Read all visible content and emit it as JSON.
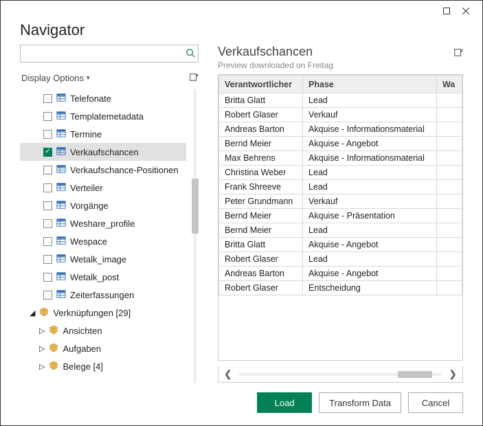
{
  "title": "Navigator",
  "search": {
    "value": ""
  },
  "display_options_label": "Display Options",
  "tree": {
    "tables": [
      {
        "label": "Telefonate",
        "checked": false,
        "selected": false
      },
      {
        "label": "Templatemetadata",
        "checked": false,
        "selected": false
      },
      {
        "label": "Termine",
        "checked": false,
        "selected": false
      },
      {
        "label": "Verkaufschancen",
        "checked": true,
        "selected": true
      },
      {
        "label": "Verkaufschance-Positionen",
        "checked": false,
        "selected": false
      },
      {
        "label": "Verteiler",
        "checked": false,
        "selected": false
      },
      {
        "label": "Vorgänge",
        "checked": false,
        "selected": false
      },
      {
        "label": "Weshare_profile",
        "checked": false,
        "selected": false
      },
      {
        "label": "Wespace",
        "checked": false,
        "selected": false
      },
      {
        "label": "Wetalk_image",
        "checked": false,
        "selected": false
      },
      {
        "label": "Wetalk_post",
        "checked": false,
        "selected": false
      },
      {
        "label": "Zeiterfassungen",
        "checked": false,
        "selected": false
      }
    ],
    "folders": [
      {
        "label": "Verknüpfungen [29]",
        "expanded": true,
        "children": [
          {
            "label": "Ansichten",
            "expanded": false
          },
          {
            "label": "Aufgaben",
            "expanded": false
          },
          {
            "label": "Belege [4]",
            "expanded": false
          }
        ]
      }
    ]
  },
  "preview": {
    "title": "Verkaufschancen",
    "subtitle": "Preview downloaded on Freitag",
    "columns": [
      "Verantwortlicher",
      "Phase",
      "Wa"
    ],
    "rows": [
      [
        "Britta Glatt",
        "Lead",
        ""
      ],
      [
        "Robert Glaser",
        "Verkauf",
        ""
      ],
      [
        "Andreas Barton",
        "Akquise - Informationsmaterial",
        ""
      ],
      [
        "Bernd Meier",
        "Akquise - Angebot",
        ""
      ],
      [
        "Max Behrens",
        "Akquise - Informationsmaterial",
        ""
      ],
      [
        "Christina Weber",
        "Lead",
        ""
      ],
      [
        "Frank Shreeve",
        "Lead",
        ""
      ],
      [
        "Peter Grundmann",
        "Verkauf",
        ""
      ],
      [
        "Bernd Meier",
        "Akquise - Präsentation",
        ""
      ],
      [
        "Bernd Meier",
        "Lead",
        ""
      ],
      [
        "Britta Glatt",
        "Akquise - Angebot",
        ""
      ],
      [
        "Robert Glaser",
        "Lead",
        ""
      ],
      [
        "Andreas Barton",
        "Akquise - Angebot",
        ""
      ],
      [
        "Robert Glaser",
        "Entscheidung",
        ""
      ]
    ]
  },
  "buttons": {
    "load": "Load",
    "transform": "Transform Data",
    "cancel": "Cancel"
  }
}
